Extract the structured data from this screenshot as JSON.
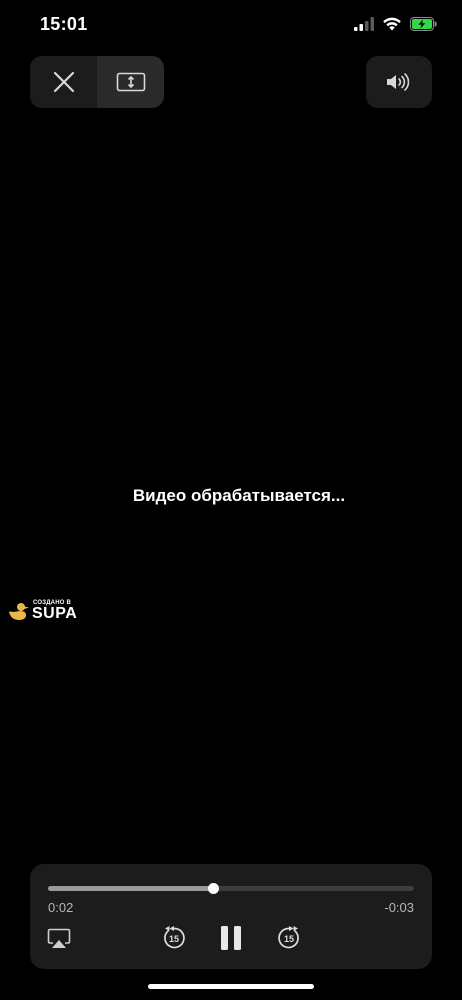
{
  "status_bar": {
    "time": "15:01",
    "icons": [
      "signal-icon",
      "wifi-icon",
      "battery-charging-icon"
    ],
    "battery_color": "#32d74b"
  },
  "top_controls": {
    "close_icon": "close-icon",
    "resize_icon": "resize-vertical-icon",
    "volume_icon": "speaker-volume-icon"
  },
  "video": {
    "status_text": "Видео обрабатывается..."
  },
  "watermark": {
    "small_text": "СОЗДАНО В",
    "brand_text": "SUPA",
    "duck_color": "#e8b84a"
  },
  "player": {
    "progress": 0.45,
    "elapsed": "0:02",
    "remaining": "-0:03",
    "skip_back_seconds": "15",
    "skip_forward_seconds": "15",
    "airplay_icon": "airplay-icon",
    "pause_icon": "pause-icon"
  }
}
